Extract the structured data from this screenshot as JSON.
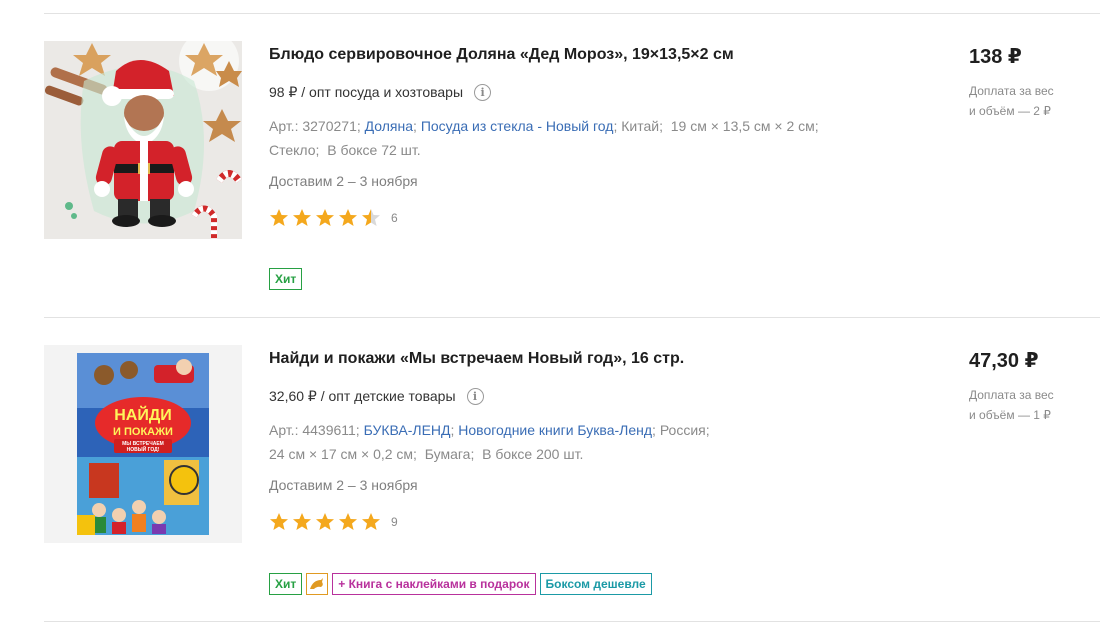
{
  "products": [
    {
      "title": "Блюдо сервировочное Доляна «Дед Мороз», 19×13,5×2 см",
      "wholesale_price": "98 ₽",
      "wholesale_text": "/ опт посуда и хозтовары",
      "specs": {
        "article": "Арт.: 3270271;",
        "brand_link": "Доляна",
        "sep1": ";",
        "category_link": "Посуда из стекла - Новый год",
        "sep2": ";",
        "rest_line1": "Китай;  19 см × 13,5 см × 2 см;",
        "line2": "Стекло;  В боксе 72 шт."
      },
      "delivery": "Доставим 2 – 3 ноября",
      "rating": 4.5,
      "rating_count": "6",
      "badges": [
        {
          "type": "hit",
          "label": "Хит"
        }
      ],
      "price": "138 ₽",
      "surcharge_line1": "Доплата за вес",
      "surcharge_line2": "и объём — 2 ₽",
      "image_icon": "santa-plate-image"
    },
    {
      "title": "Найди и покажи «Мы встречаем Новый год», 16 стр.",
      "wholesale_price": "32,60 ₽",
      "wholesale_text": "/ опт детские товары",
      "specs": {
        "article": "Арт.: 4439611;",
        "brand_link": "БУКВА-ЛЕНД",
        "sep1": ";",
        "category_link": "Новогодние книги Буква-Ленд",
        "sep2": ";",
        "rest_line1": "Россия;",
        "line2": "24 см × 17 см × 0,2 см;  Бумага;  В боксе 200 шт."
      },
      "delivery": "Доставим 2 – 3 ноября",
      "rating": 5,
      "rating_count": "9",
      "badges": [
        {
          "type": "hit",
          "label": "Хит"
        },
        {
          "type": "icon",
          "label": "",
          "icon": "dolphin-icon"
        },
        {
          "type": "gift",
          "label": "+ Книга с наклейками в подарок"
        },
        {
          "type": "box",
          "label": "Боксом дешевле"
        }
      ],
      "price": "47,30 ₽",
      "surcharge_line1": "Доплата за вес",
      "surcharge_line2": "и объём — 1 ₽",
      "image_icon": "book-cover-image",
      "book_cover": {
        "title_line1": "НАЙДИ",
        "title_line2": "И ПОКАЖИ",
        "subtitle_line1": "МЫ ВСТРЕЧАЕМ",
        "subtitle_line2": "НОВЫЙ ГОД!"
      }
    }
  ],
  "colors": {
    "star": "#f4a81d",
    "star_empty": "#d9d9d9",
    "link": "#3a6db5",
    "hit": "#27a043",
    "gift": "#b8319c",
    "box": "#1b9aa6"
  }
}
